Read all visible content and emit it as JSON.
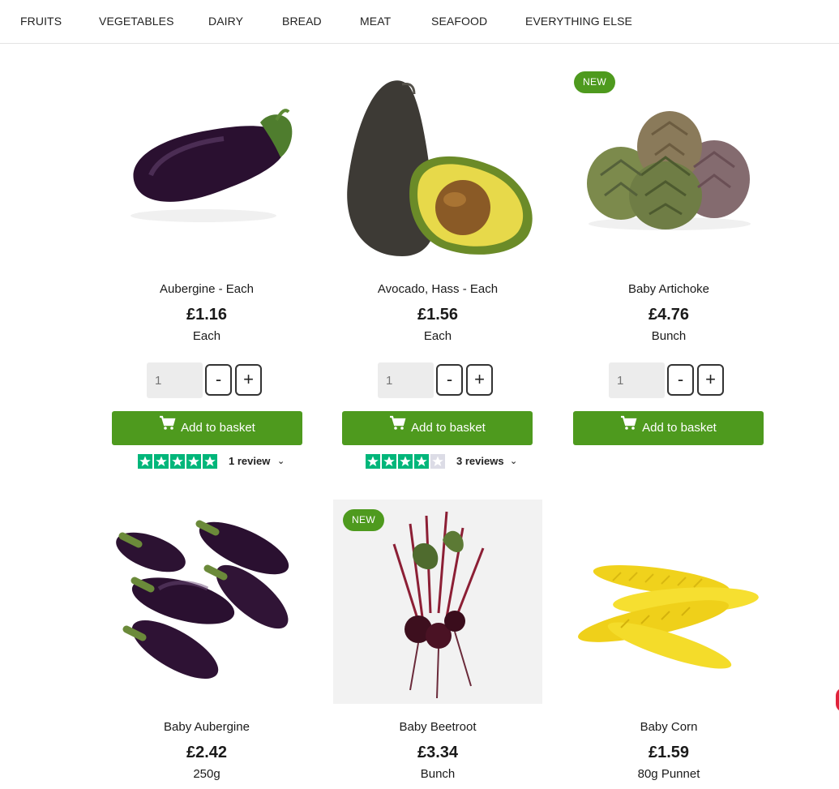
{
  "nav": {
    "items": [
      "FRUITS",
      "VEGETABLES",
      "DAIRY",
      "BREAD",
      "MEAT",
      "SEAFOOD",
      "EVERYTHING ELSE"
    ]
  },
  "products": [
    {
      "name": "Aubergine - Each",
      "price": "£1.16",
      "unit": "Each",
      "qty_placeholder": "1",
      "minus": "-",
      "plus": "+",
      "add_label": "Add to basket",
      "review_label": "1 review",
      "rating": 5
    },
    {
      "name": "Avocado, Hass - Each",
      "price": "£1.56",
      "unit": "Each",
      "qty_placeholder": "1",
      "minus": "-",
      "plus": "+",
      "add_label": "Add to basket",
      "review_label": "3 reviews",
      "rating": 4
    },
    {
      "name": "Baby Artichoke",
      "price": "£4.76",
      "unit": "Bunch",
      "badge": "NEW",
      "qty_placeholder": "1",
      "minus": "-",
      "plus": "+",
      "add_label": "Add to basket"
    },
    {
      "name": "Baby Aubergine",
      "price": "£2.42",
      "unit": "250g"
    },
    {
      "name": "Baby Beetroot",
      "price": "£3.34",
      "unit": "Bunch",
      "badge": "NEW"
    },
    {
      "name": "Baby Corn",
      "price": "£1.59",
      "unit": "80g Punnet"
    }
  ],
  "icons": {
    "cart": "cart-icon",
    "star": "star-icon",
    "chevron": "chevron-down-icon"
  },
  "colors": {
    "accent_green": "#4e9a1e",
    "trustpilot_green": "#00b67a",
    "star_empty": "#dcdce6"
  }
}
